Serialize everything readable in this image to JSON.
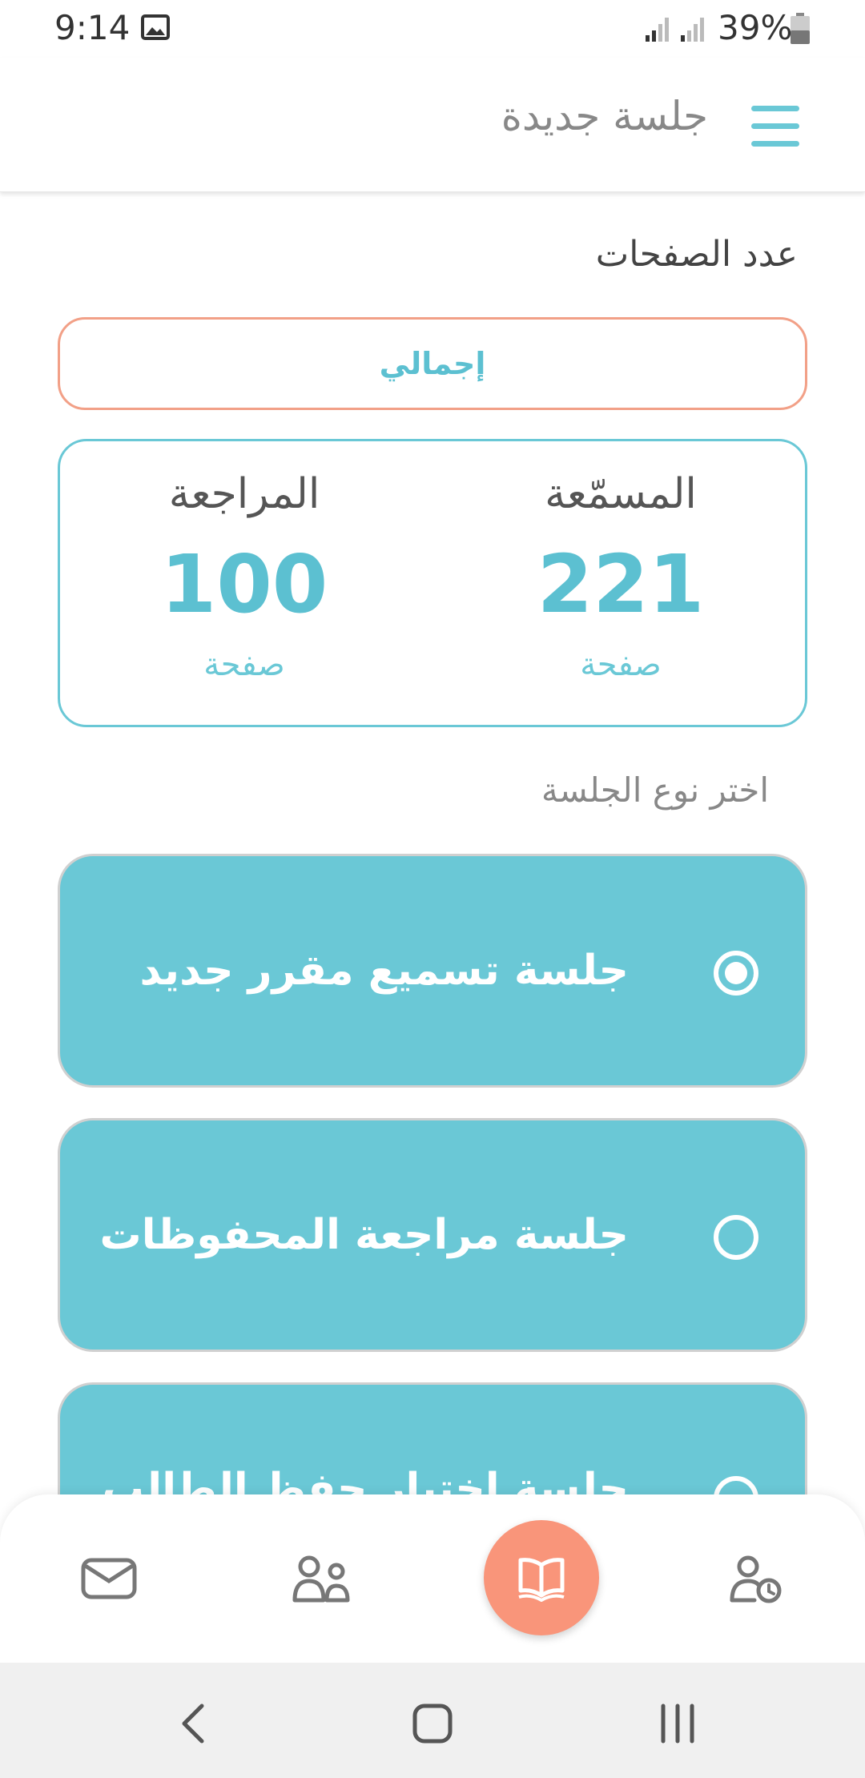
{
  "status_bar": {
    "time": "9:14",
    "battery": "39%"
  },
  "app_bar": {
    "title": "جلسة جديدة"
  },
  "pages": {
    "title": "عدد الصفحات",
    "total_button": "إجمالي",
    "stats": [
      {
        "label": "المسمّعة",
        "value": "221",
        "unit": "صفحة"
      },
      {
        "label": "المراجعة",
        "value": "100",
        "unit": "صفحة"
      }
    ]
  },
  "session": {
    "choose_label": "اختر نوع الجلسة",
    "options": [
      {
        "label": "جلسة تسميع مقرر جديد",
        "selected": true
      },
      {
        "label": "جلسة مراجعة المحفوظات",
        "selected": false
      },
      {
        "label": "جلسة اختبار حفظ الطالب",
        "selected": false
      }
    ]
  },
  "bottom_nav": {
    "items": [
      "mail-icon",
      "students-icon",
      "book-icon",
      "user-clock-icon"
    ]
  },
  "colors": {
    "accent": "#6ac8d6",
    "accent_text": "#5cc0d1",
    "fab": "#f9957a",
    "outline": "#f2a087"
  }
}
